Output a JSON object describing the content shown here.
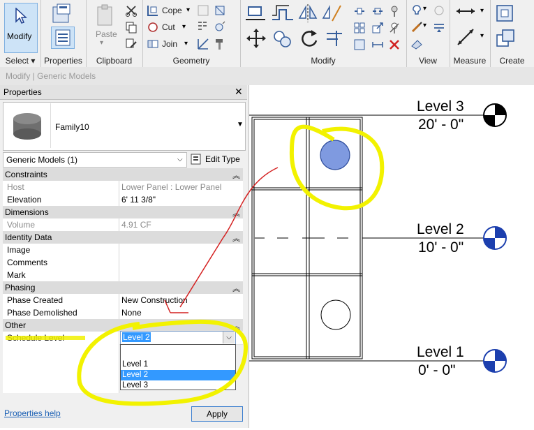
{
  "ribbon": {
    "panels": {
      "select": {
        "label": "Select",
        "modify_label": "Modify"
      },
      "properties": {
        "label": "Properties"
      },
      "clipboard": {
        "label": "Clipboard",
        "paste_label": "Paste"
      },
      "geometry": {
        "label": "Geometry",
        "cope_label": "Cope",
        "cut_label": "Cut",
        "join_label": "Join"
      },
      "modify": {
        "label": "Modify"
      },
      "view": {
        "label": "View"
      },
      "measure": {
        "label": "Measure"
      },
      "create": {
        "label": "Create"
      }
    }
  },
  "context_bar": {
    "text": "Modify | Generic Models"
  },
  "properties": {
    "title": "Properties",
    "family_name": "Family10",
    "type_selector": "Generic Models (1)",
    "edit_type_label": "Edit Type",
    "sections": {
      "constraints": {
        "title": "Constraints",
        "host_key": "Host",
        "host_val": "Lower Panel : Lower Panel",
        "elev_key": "Elevation",
        "elev_val": "6'  11 3/8\""
      },
      "dimensions": {
        "title": "Dimensions",
        "vol_key": "Volume",
        "vol_val": "4.91 CF"
      },
      "identity": {
        "title": "Identity Data",
        "image_key": "Image",
        "comments_key": "Comments",
        "mark_key": "Mark"
      },
      "phasing": {
        "title": "Phasing",
        "created_key": "Phase Created",
        "created_val": "New Construction",
        "demolished_key": "Phase Demolished",
        "demolished_val": "None"
      },
      "other": {
        "title": "Other",
        "schedule_key": "Schedule Level",
        "schedule_val": "Level 2"
      }
    },
    "dropdown_options": [
      "Level 1",
      "Level 2",
      "Level 3"
    ],
    "help_link": "Properties help",
    "apply_label": "Apply"
  },
  "levels": [
    {
      "name": "Level 3",
      "elev": "20' - 0\""
    },
    {
      "name": "Level 2",
      "elev": "10' - 0\""
    },
    {
      "name": "Level 1",
      "elev": "0' - 0\""
    }
  ],
  "colors": {
    "highlight": "#f2f200",
    "selection": "#3399ff",
    "annotation_arrow": "#d42020",
    "blue_circle": "#7f9ae0",
    "level_marker": "#1c3fae"
  }
}
